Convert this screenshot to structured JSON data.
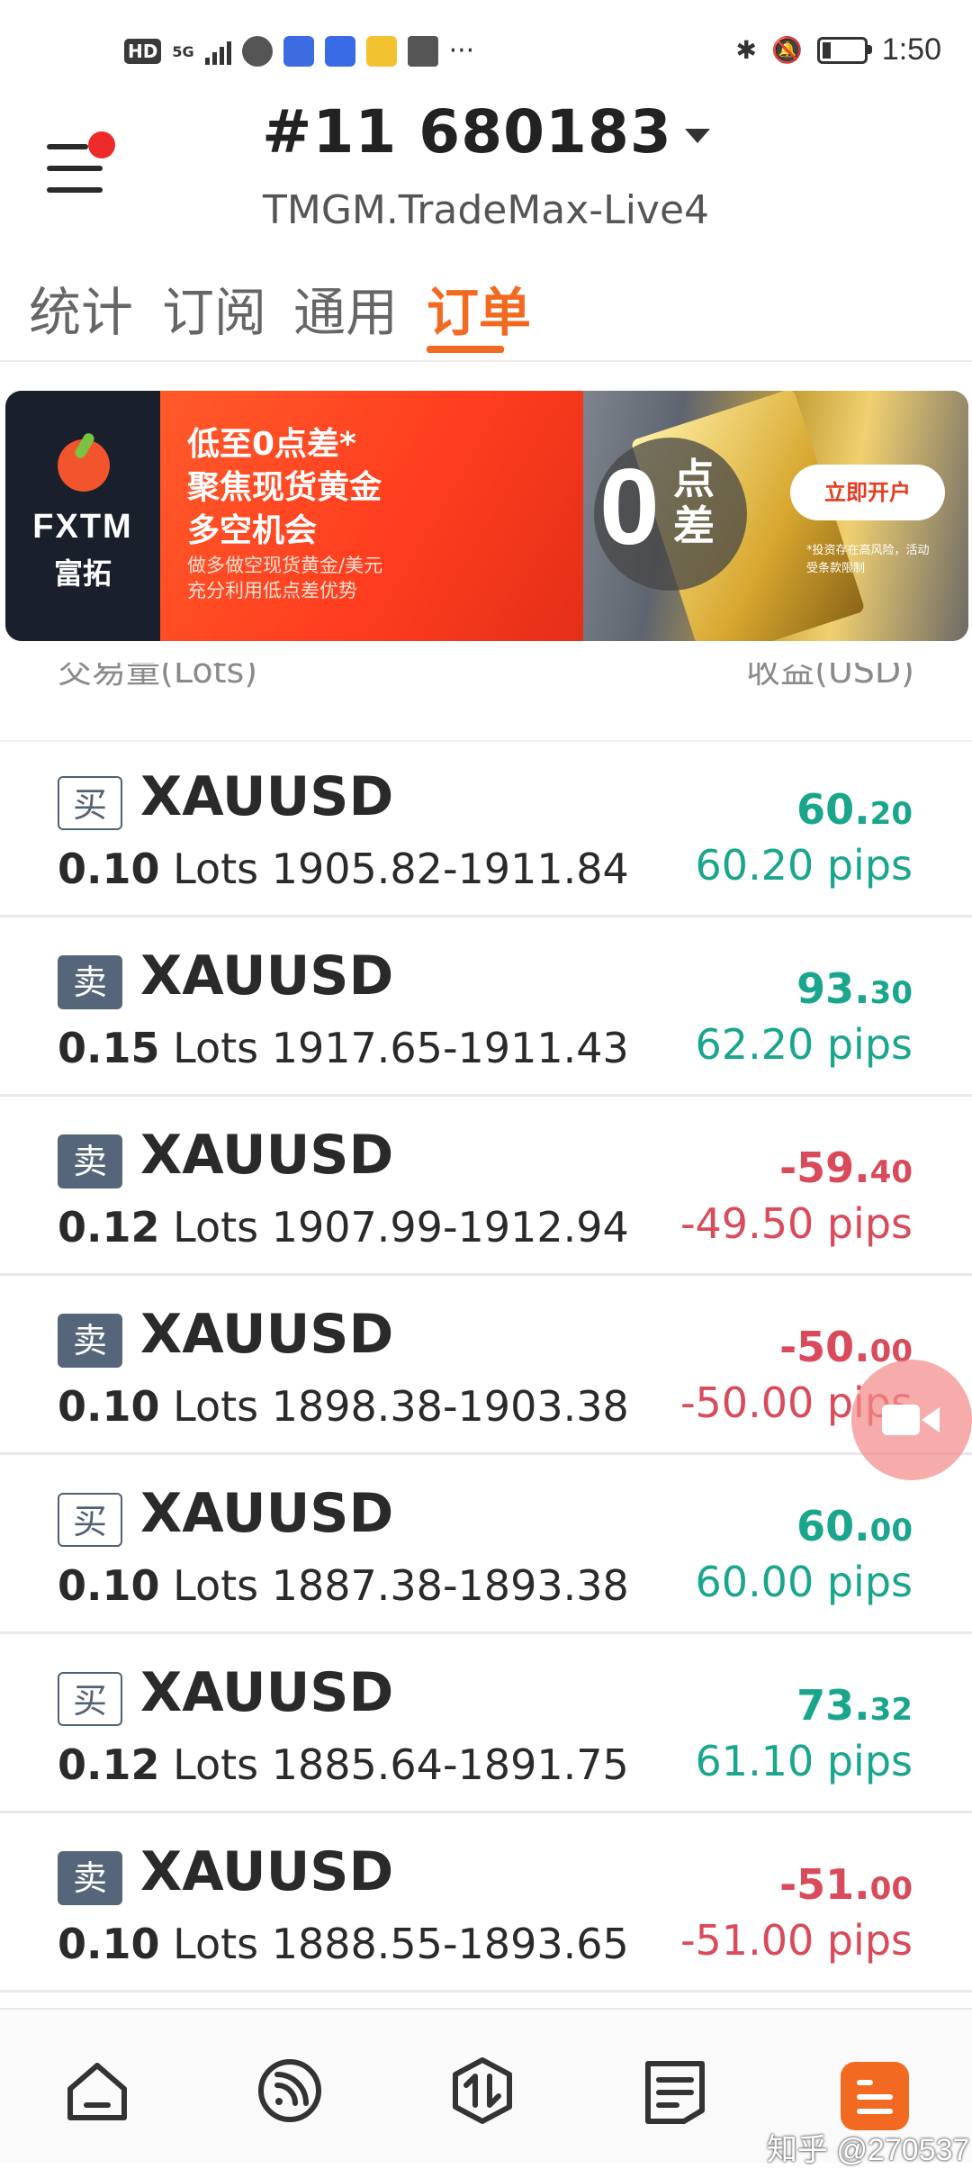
{
  "status_bar": {
    "left": {
      "hd": "HD",
      "signal": "5G",
      "icons": [
        "globe-icon",
        "video-icon",
        "video-icon",
        "mail-icon",
        "envelope-icon"
      ],
      "more": "···"
    },
    "time": "1:50",
    "battery_level": 0.2
  },
  "header": {
    "account_number": "#11  680183",
    "server": "TMGM.TradeMax-Live4"
  },
  "tabs": [
    {
      "label": "统计",
      "active": false
    },
    {
      "label": "订阅",
      "active": false
    },
    {
      "label": "通用",
      "active": false
    },
    {
      "label": "订单",
      "active": true
    }
  ],
  "banner": {
    "brand": "FXTM",
    "brand_cn": "富拓",
    "line1": "低至0点差*",
    "line2": "聚焦现货黄金",
    "line3": "多空机会",
    "line4": "做多做空现货黄金/美元",
    "line5": "充分利用低点差优势",
    "zero": "0",
    "zero_label": "点差",
    "cta": "立即开户",
    "disclaimer": "*投资存在高风险，活动受条款限制"
  },
  "list_header": {
    "left": "交易量(Lots)",
    "right": "收益(USD)"
  },
  "orders": [
    {
      "side": "买",
      "type": "buy",
      "symbol": "XAUUSD",
      "lots": "0.10",
      "lots_unit": "Lots",
      "range": "1905.82-1911.84",
      "profit_int": "60.",
      "profit_dec": "20",
      "pips": "60.20 pips",
      "positive": true
    },
    {
      "side": "卖",
      "type": "sell",
      "symbol": "XAUUSD",
      "lots": "0.15",
      "lots_unit": "Lots",
      "range": "1917.65-1911.43",
      "profit_int": "93.",
      "profit_dec": "30",
      "pips": "62.20 pips",
      "positive": true
    },
    {
      "side": "卖",
      "type": "sell",
      "symbol": "XAUUSD",
      "lots": "0.12",
      "lots_unit": "Lots",
      "range": "1907.99-1912.94",
      "profit_int": "-59.",
      "profit_dec": "40",
      "pips": "-49.50 pips",
      "positive": false
    },
    {
      "side": "卖",
      "type": "sell",
      "symbol": "XAUUSD",
      "lots": "0.10",
      "lots_unit": "Lots",
      "range": "1898.38-1903.38",
      "profit_int": "-50.",
      "profit_dec": "00",
      "pips": "-50.00 pips",
      "positive": false
    },
    {
      "side": "买",
      "type": "buy",
      "symbol": "XAUUSD",
      "lots": "0.10",
      "lots_unit": "Lots",
      "range": "1887.38-1893.38",
      "profit_int": "60.",
      "profit_dec": "00",
      "pips": "60.00 pips",
      "positive": true
    },
    {
      "side": "买",
      "type": "buy",
      "symbol": "XAUUSD",
      "lots": "0.12",
      "lots_unit": "Lots",
      "range": "1885.64-1891.75",
      "profit_int": "73.",
      "profit_dec": "32",
      "pips": "61.10 pips",
      "positive": true
    },
    {
      "side": "卖",
      "type": "sell",
      "symbol": "XAUUSD",
      "lots": "0.10",
      "lots_unit": "Lots",
      "range": "1888.55-1893.65",
      "profit_int": "-51.",
      "profit_dec": "00",
      "pips": "-51.00 pips",
      "positive": false
    }
  ],
  "bottom_nav": {
    "items": [
      "home-icon",
      "signal-icon",
      "trade-icon",
      "document-icon",
      "profile-icon"
    ],
    "active_index": 4
  },
  "watermark": "知乎 @270537",
  "colors": {
    "accent": "#f26a21",
    "positive": "#1aa68c",
    "negative": "#d94a5a",
    "badge": "#55667a"
  }
}
